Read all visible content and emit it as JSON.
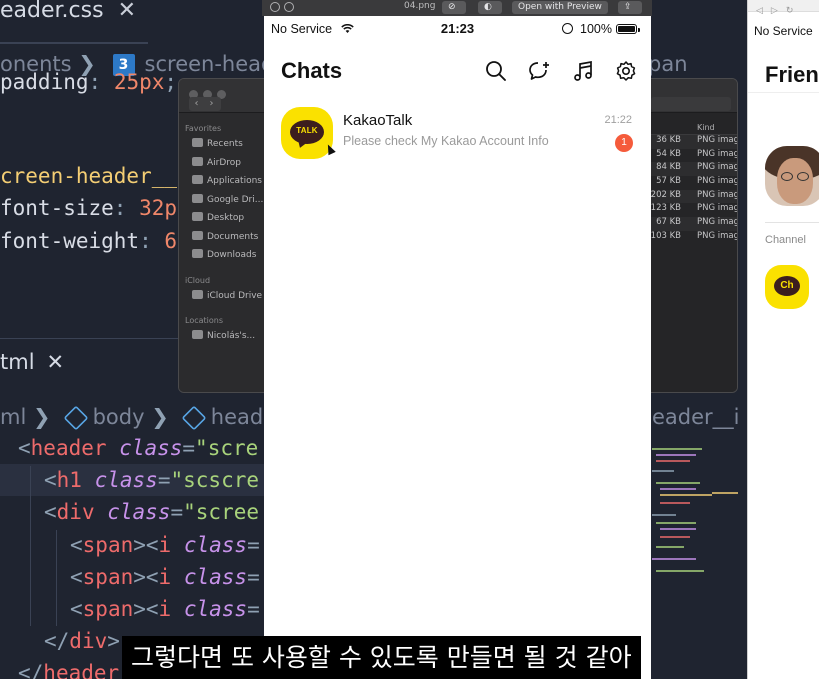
{
  "editor": {
    "css_tab_title": "eader.css",
    "css_breadcrumb_left": "onents",
    "css_breadcrumb_file": "screen-head",
    "css_right_crumb": "pan",
    "css_lines": {
      "l1_prop": "padding",
      "l1_val": "25px",
      "l2_sel": "creen-header__",
      "l3_prop": "font-size",
      "l3_val": "32p",
      "l4_prop": "font-weight",
      "l4_val": "6"
    },
    "html_tab_title": "tml",
    "html_crumb_a": "ml",
    "html_crumb_b": "body",
    "html_crumb_c": "head",
    "html_right_crumb": "eader__i",
    "html_lines": {
      "l1_tag": "header",
      "l1_attr": "class",
      "l1_str": "scre",
      "l2_tag": "h1",
      "l2_attr": "class",
      "l2_str": "scscre",
      "l3_tag": "div",
      "l3_attr": "class",
      "l3_str": "scree",
      "l4_tag": "span",
      "l4_inner": "i",
      "l4_attr": "class",
      "l7_tag": "div",
      "l8_tag": "header"
    }
  },
  "finder": {
    "sections": {
      "favorites": "Favorites",
      "icloud": "iCloud",
      "locations": "Locations"
    },
    "favorites": [
      "Recents",
      "AirDrop",
      "Applications",
      "Google Dri...",
      "Desktop",
      "Documents",
      "Downloads"
    ],
    "icloud_items": [
      "iCloud Drive"
    ],
    "location_items": [
      "Nicolás's..."
    ],
    "kind_header": "Kind",
    "files": [
      {
        "size": "36 KB",
        "kind": "PNG imag"
      },
      {
        "size": "54 KB",
        "kind": "PNG imag"
      },
      {
        "size": "84 KB",
        "kind": "PNG imag"
      },
      {
        "size": "57 KB",
        "kind": "PNG imag"
      },
      {
        "size": "202 KB",
        "kind": "PNG imag"
      },
      {
        "size": "123 KB",
        "kind": "PNG imag"
      },
      {
        "size": "67 KB",
        "kind": "PNG imag"
      },
      {
        "size": "103 KB",
        "kind": "PNG imag"
      }
    ]
  },
  "preview": {
    "filename": "04.png",
    "open_with": "Open with Preview"
  },
  "phone": {
    "status": {
      "carrier": "No Service",
      "time": "21:23",
      "battery": "100%"
    },
    "title": "Chats",
    "icons": [
      "search-icon",
      "new-chat-icon",
      "music-icon",
      "settings-icon"
    ],
    "chats": [
      {
        "name": "KakaoTalk",
        "avatar_label": "TALK",
        "preview": "Please check My Kakao Account Info",
        "time": "21:22",
        "unread": "1"
      }
    ]
  },
  "browser": {
    "carrier": "No Service",
    "title": "Frien",
    "section": "Channel",
    "channel_icon_label": "Ch"
  },
  "subtitle": "그렇다면 또 사용할 수 있도록 만들면 될 것 같아",
  "colors": {
    "kakao_yellow": "#fae100",
    "kakao_brown": "#3c1e1e",
    "badge_red": "#f55b3b",
    "editor_bg": "#1f2430"
  }
}
